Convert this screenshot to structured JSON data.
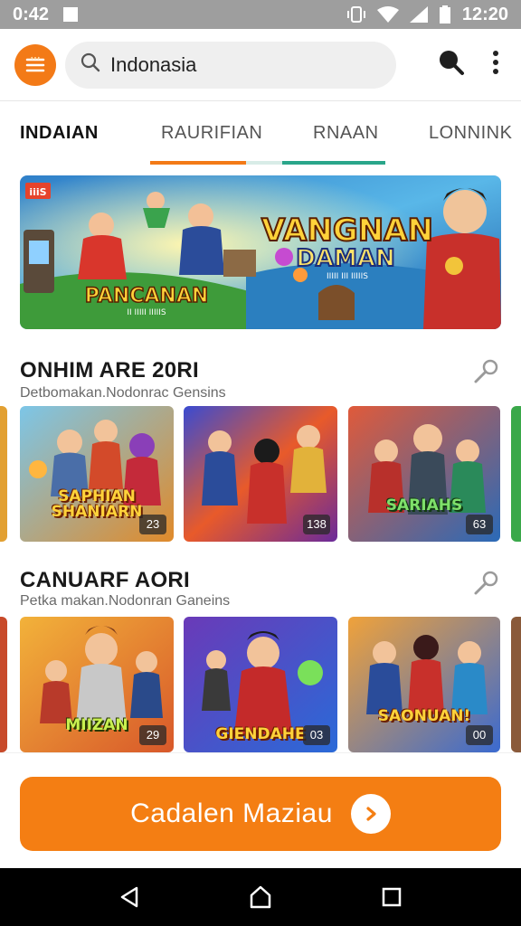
{
  "status": {
    "time_left": "0:42",
    "time_right": "12:20"
  },
  "search": {
    "value": "Indonasia",
    "placeholder": "Indonasia"
  },
  "tabs": [
    {
      "label": "INDAIAN",
      "active": true
    },
    {
      "label": "RAURIFIAN",
      "active": false
    },
    {
      "label": "RNAAN",
      "active": false
    },
    {
      "label": "LONNINK",
      "active": false
    }
  ],
  "tab_indicator_colors": [
    "#f37a17",
    "#2aa68a"
  ],
  "banner": {
    "badge": "iiiS",
    "headline_1": "VANGNAN",
    "headline_2": "DAMAN",
    "headline_sub": "IIIII III IIIIIS",
    "left_title": "PANCANAN",
    "left_sub": "II IIIII IIIIIS"
  },
  "sections": [
    {
      "title": "ONHIM ARE 20RI",
      "subtitle": "Detbomakan.Nodonrac Gensins",
      "cards": [
        {
          "title": "SAPHIAN SHANIARN",
          "count": "23"
        },
        {
          "title": "",
          "count": "138"
        },
        {
          "title": "SARIAHS",
          "count": "63"
        }
      ]
    },
    {
      "title": "CANUARF AORI",
      "subtitle": "Petka makan.Nodonran Ganeins",
      "cards": [
        {
          "title": "MIIZAN",
          "count": "29"
        },
        {
          "title": "GIENDAHE",
          "count": "03"
        },
        {
          "title": "SAONUAN!",
          "count": "00"
        }
      ]
    }
  ],
  "cta": {
    "label": "Cadalen Maziau"
  },
  "colors": {
    "accent": "#f37a17",
    "teal": "#2aa68a",
    "cta": "#f47e13"
  },
  "icons": [
    "menu-logo-icon",
    "search-icon",
    "voice-search-icon",
    "more-vert-icon",
    "pin-icon",
    "arrow-right-icon",
    "nav-back-icon",
    "nav-home-icon",
    "nav-recents-icon"
  ]
}
